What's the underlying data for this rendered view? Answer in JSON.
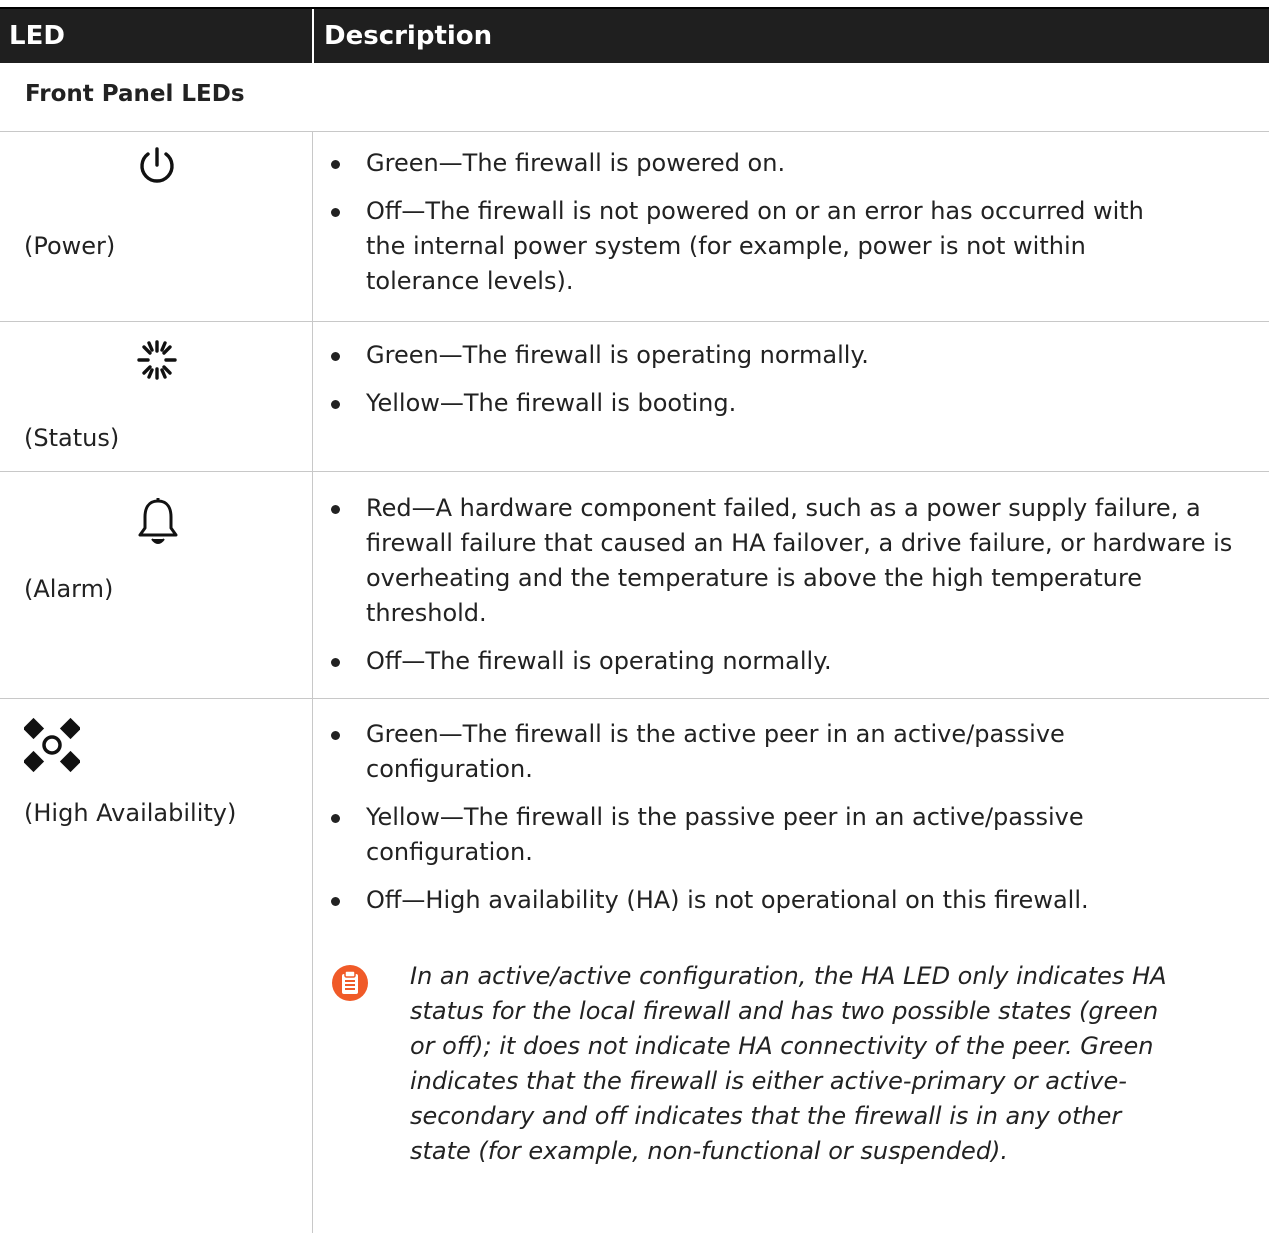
{
  "table": {
    "headers": {
      "led": "LED",
      "description": "Description"
    },
    "section_title": "Front Panel LEDs",
    "rows": [
      {
        "label": "(Power)",
        "icon": "power-icon",
        "items": [
          "Green—The firewall is powered on.",
          "Off—The firewall is not powered on or an error has occurred with the internal power system (for example, power is not within tolerance levels)."
        ]
      },
      {
        "label": "(Status)",
        "icon": "status-spinner-icon",
        "items": [
          "Green—The firewall is operating normally.",
          "Yellow—The firewall is booting."
        ]
      },
      {
        "label": "(Alarm)",
        "icon": "bell-icon",
        "items": [
          "Red—A hardware component failed, such as a power supply failure, a firewall failure that caused an HA failover, a drive failure, or hardware is overheating and the temperature is above the high temperature threshold.",
          "Off—The firewall is operating normally."
        ]
      },
      {
        "label": "(High Availability)",
        "icon": "high-availability-icon",
        "items": [
          "Green—The firewall is the active peer in an active/passive configuration.",
          "Yellow—The firewall is the passive peer in an active/passive configuration.",
          "Off—High availability (HA) is not operational on this firewall."
        ],
        "note": "In an active/active configuration, the HA LED only indicates HA status for the local firewall and has two possible states (green or off); it does not indicate HA connectivity of the peer. Green indicates that the firewall is either active-primary or active-secondary and off indicates that the firewall is in any other state (for example, non-functional or suspended).",
        "note_icon": "note-clipboard-icon",
        "note_icon_color": "#f05a28"
      }
    ]
  }
}
